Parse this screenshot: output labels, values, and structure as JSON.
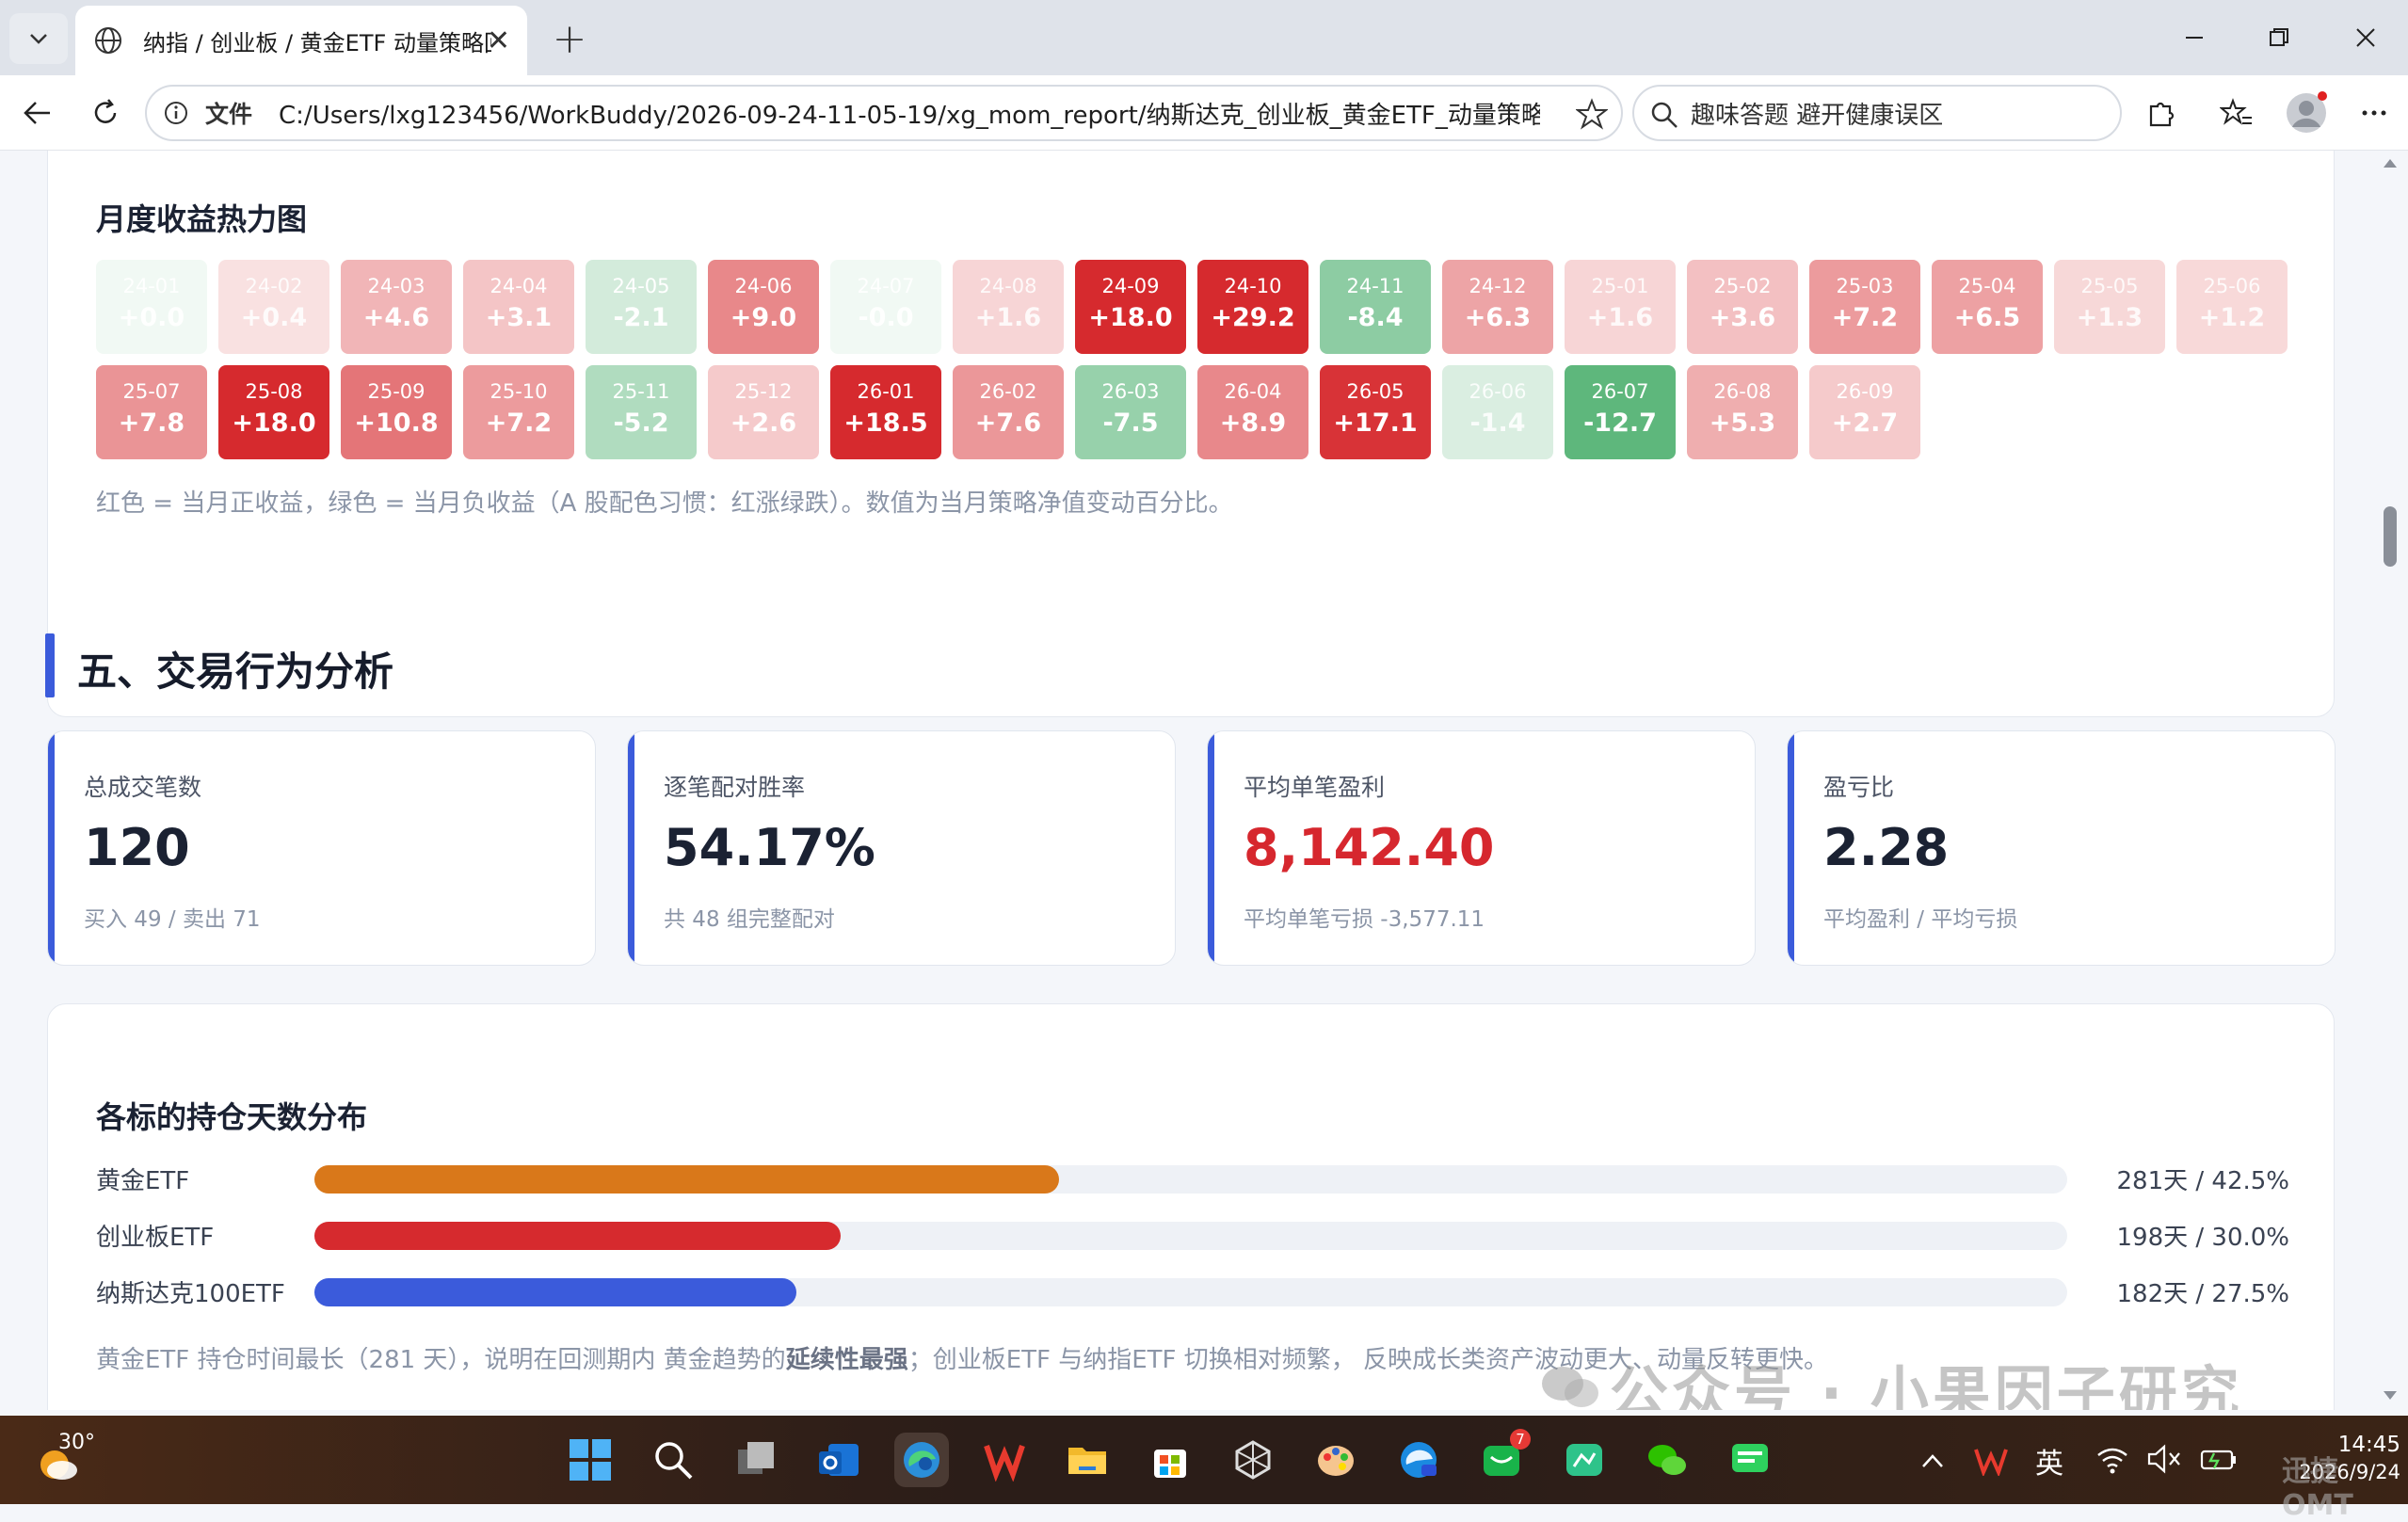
{
  "browser": {
    "tab_title": "纳指 / 创业板 / 黄金ETF 动量策略回",
    "address_label": "文件",
    "url": "C:/Users/lxg123456/WorkBuddy/2026-09-24-11-05-19/xg_mom_report/纳斯达克_创业板_黄金ETF_动量策略...",
    "search_text": "趣味答题 避开健康误区"
  },
  "heatmap": {
    "title": "月度收益热力图",
    "cells": [
      {
        "m": "24-01",
        "v": "+0.0"
      },
      {
        "m": "24-02",
        "v": "+0.4"
      },
      {
        "m": "24-03",
        "v": "+4.6"
      },
      {
        "m": "24-04",
        "v": "+3.1"
      },
      {
        "m": "24-05",
        "v": "-2.1"
      },
      {
        "m": "24-06",
        "v": "+9.0"
      },
      {
        "m": "24-07",
        "v": "-0.0"
      },
      {
        "m": "24-08",
        "v": "+1.6"
      },
      {
        "m": "24-09",
        "v": "+18.0"
      },
      {
        "m": "24-10",
        "v": "+29.2"
      },
      {
        "m": "24-11",
        "v": "-8.4"
      },
      {
        "m": "24-12",
        "v": "+6.3"
      },
      {
        "m": "25-01",
        "v": "+1.6"
      },
      {
        "m": "25-02",
        "v": "+3.6"
      },
      {
        "m": "25-03",
        "v": "+7.2"
      },
      {
        "m": "25-04",
        "v": "+6.5"
      },
      {
        "m": "25-05",
        "v": "+1.3"
      },
      {
        "m": "25-06",
        "v": "+1.2"
      },
      {
        "m": "25-07",
        "v": "+7.8"
      },
      {
        "m": "25-08",
        "v": "+18.0"
      },
      {
        "m": "25-09",
        "v": "+10.8"
      },
      {
        "m": "25-10",
        "v": "+7.2"
      },
      {
        "m": "25-11",
        "v": "-5.2"
      },
      {
        "m": "25-12",
        "v": "+2.6"
      },
      {
        "m": "26-01",
        "v": "+18.5"
      },
      {
        "m": "26-02",
        "v": "+7.6"
      },
      {
        "m": "26-03",
        "v": "-7.5"
      },
      {
        "m": "26-04",
        "v": "+8.9"
      },
      {
        "m": "26-05",
        "v": "+17.1"
      },
      {
        "m": "26-06",
        "v": "-1.4"
      },
      {
        "m": "26-07",
        "v": "-12.7"
      },
      {
        "m": "26-08",
        "v": "+5.3"
      },
      {
        "m": "26-09",
        "v": "+2.7"
      }
    ],
    "note": "红色 = 当月正收益，绿色 = 当月负收益（A 股配色习惯：红涨绿跌）。数值为当月策略净值变动百分比。"
  },
  "section5": {
    "title": "五、交易行为分析",
    "stats": [
      {
        "label": "总成交笔数",
        "value": "120",
        "sub": "买入 49 / 卖出 71",
        "color": "#1b2233"
      },
      {
        "label": "逐笔配对胜率",
        "value": "54.17%",
        "sub": "共 48 组完整配对",
        "color": "#1b2233"
      },
      {
        "label": "平均单笔盈利",
        "value": "8,142.40",
        "sub": "平均单笔亏损 -3,577.11",
        "color": "#d6272e"
      },
      {
        "label": "盈亏比",
        "value": "2.28",
        "sub": "平均盈利 / 平均亏损",
        "color": "#1b2233"
      }
    ]
  },
  "holding": {
    "title": "各标的持仓天数分布",
    "rows": [
      {
        "name": "黄金ETF",
        "pct": 42.5,
        "label": "281天 / 42.5%",
        "color": "#d9781a"
      },
      {
        "name": "创业板ETF",
        "pct": 30.0,
        "label": "198天 / 30.0%",
        "color": "#d62a2e"
      },
      {
        "name": "纳斯达克100ETF",
        "pct": 27.5,
        "label": "182天 / 27.5%",
        "color": "#3b5bdb"
      }
    ],
    "note_a": "黄金ETF 持仓时间最长（281 天），说明在回测期内 黄金趋势的",
    "note_b": "延续性最强",
    "note_c": "；创业板ETF 与纳指ETF 切换相对频繁， 反映成长类资产波动更大、动量反转更快。"
  },
  "watermark": "公众号 · 小果因子研究",
  "taskbar": {
    "weather_temp": "30°",
    "time": "14:45",
    "date": "2026/9/24",
    "ime": "英",
    "brand": "迅捷OMT",
    "mail_badge": "7"
  }
}
